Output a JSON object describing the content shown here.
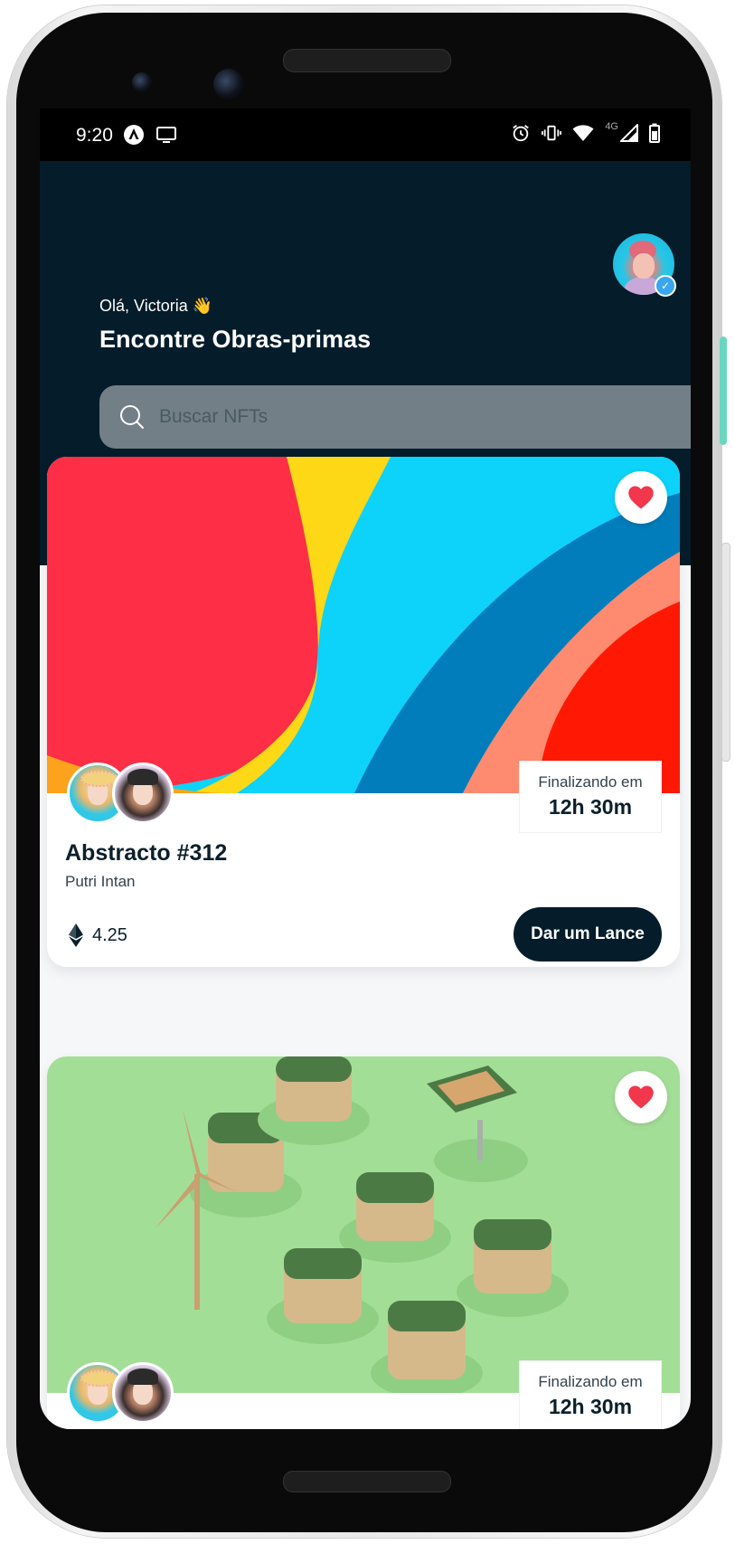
{
  "status_bar": {
    "time": "9:20",
    "network": "4G",
    "left_icons": [
      "app-notification-icon",
      "cast-icon"
    ],
    "right_icons": [
      "alarm-icon",
      "vibrate-icon",
      "wifi-icon",
      "signal-icon",
      "battery-icon"
    ]
  },
  "header": {
    "greeting": "Olá, Victoria 👋",
    "title": "Encontre Obras-primas",
    "avatar_badge": "verified-badge-icon"
  },
  "search": {
    "placeholder": "Buscar NFTs",
    "icon": "search-icon"
  },
  "colors": {
    "header_bg": "#051c2a",
    "accent_dark": "#051c2a",
    "favorite_heart": "#f2364b",
    "search_bg": "#727f86"
  },
  "cards": [
    {
      "favorite_icon": "heart-icon",
      "timer_label": "Finalizando em",
      "timer_value": "12h 30m",
      "name": "Abstracto #312",
      "creator": "Putri Intan",
      "price": "4.25",
      "price_icon": "ethereum-icon",
      "bid_label": "Dar um Lance"
    },
    {
      "favorite_icon": "heart-icon",
      "timer_label": "Finalizando em",
      "timer_value": "12h 30m"
    }
  ]
}
